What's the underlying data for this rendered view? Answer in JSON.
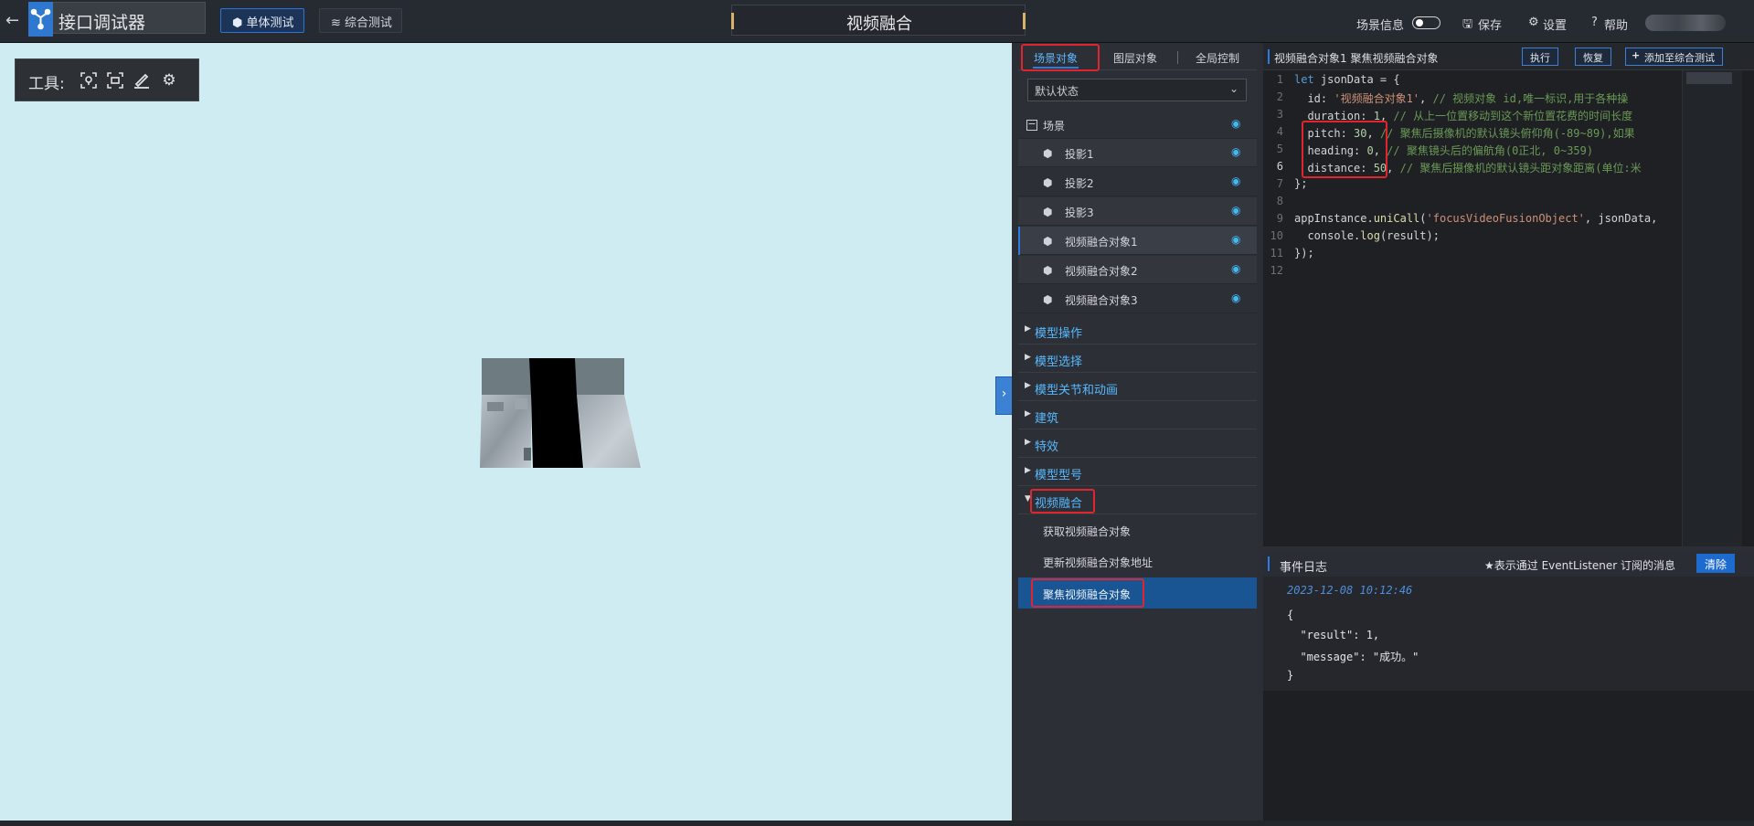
{
  "header": {
    "back_icon": "back-arrow-icon",
    "logo_icon": "cube-network-logo-icon",
    "app_title": "接口调试器",
    "mode_tabs": [
      {
        "label": "单体测试",
        "icon": "cube-icon",
        "active": true
      },
      {
        "label": "综合测试",
        "icon": "layers-icon",
        "active": false
      }
    ],
    "page_title": "视频融合",
    "scene_info_label": "场景信息",
    "scene_info_toggle": false,
    "save_label": "保存",
    "settings_label": "设置",
    "help_label": "帮助",
    "accent_color": "#2e74d6"
  },
  "toolbox": {
    "label": "工具:",
    "tools": [
      "locate-icon",
      "frame-select-icon",
      "pen-icon",
      "settings-gears-icon"
    ]
  },
  "panel": {
    "tabs": [
      "场景对象",
      "图层对象",
      "全局控制"
    ],
    "active_tab": "场景对象",
    "state_select": "默认状态",
    "tree_root": "场景",
    "tree_items": [
      "投影1",
      "投影2",
      "投影3",
      "视频融合对象1",
      "视频融合对象2",
      "视频融合对象3"
    ],
    "selected_item": "视频融合对象1",
    "categories": [
      "模型操作",
      "模型选择",
      "模型关节和动画",
      "建筑",
      "特效",
      "模型型号",
      "视频融合"
    ],
    "subitems": [
      "获取视频融合对象",
      "更新视频融合对象地址",
      "聚焦视频融合对象"
    ],
    "selected_subitem": "聚焦视频融合对象"
  },
  "editor": {
    "title": "视频融合对象1 聚焦视频融合对象",
    "execute_label": "执行",
    "restore_label": "恢复",
    "add_label": "添加至综合测试",
    "line_numbers": [
      "1",
      "2",
      "3",
      "4",
      "5",
      "6",
      "7",
      "8",
      "9",
      "10",
      "11",
      "12"
    ],
    "current_line": "6",
    "code": {
      "l1_kw": "let",
      "l1_rest": " jsonData = {",
      "l2_key": "  id: ",
      "l2_str": "'视频融合对象1'",
      "l2_comma": ", ",
      "l2_cm": "// 视频对象 id,唯一标识,用于各种操",
      "l3_key": "  duration: ",
      "l3_num": "1",
      "l3_comma": ", ",
      "l3_cm": "// 从上一位置移动到这个新位置花费的时间长度",
      "l4_key": "  pitch: ",
      "l4_num": "30",
      "l4_comma": ", ",
      "l4_cm": "// 聚焦后摄像机的默认镜头俯仰角(-89~89),如果",
      "l5_key": "  heading: ",
      "l5_num": "0",
      "l5_comma": ", ",
      "l5_cm": "// 聚焦镜头后的偏航角(0正北, 0~359)",
      "l6_key": "  distance: ",
      "l6_num": "50",
      "l6_comma": ", ",
      "l6_cm": "// 聚焦后摄像机的默认镜头距对象距离(单位:米",
      "l7": "};",
      "l9_pre": "appInstance.",
      "l9_fn": "uniCall",
      "l9_mid": "(",
      "l9_str": "'focusVideoFusionObject'",
      "l9_post": ", jsonData,",
      "l10_pre": "  console.",
      "l10_fn": "log",
      "l10_post": "(result);",
      "l11": "});"
    }
  },
  "log": {
    "title": "事件日志",
    "note": "★表示通过 EventListener 订阅的消息",
    "clear_label": "清除",
    "timestamp": "2023-12-08 10:12:46",
    "lines": [
      "{",
      "  \"result\": 1,",
      "  \"message\": \"成功。\"",
      "}"
    ]
  }
}
